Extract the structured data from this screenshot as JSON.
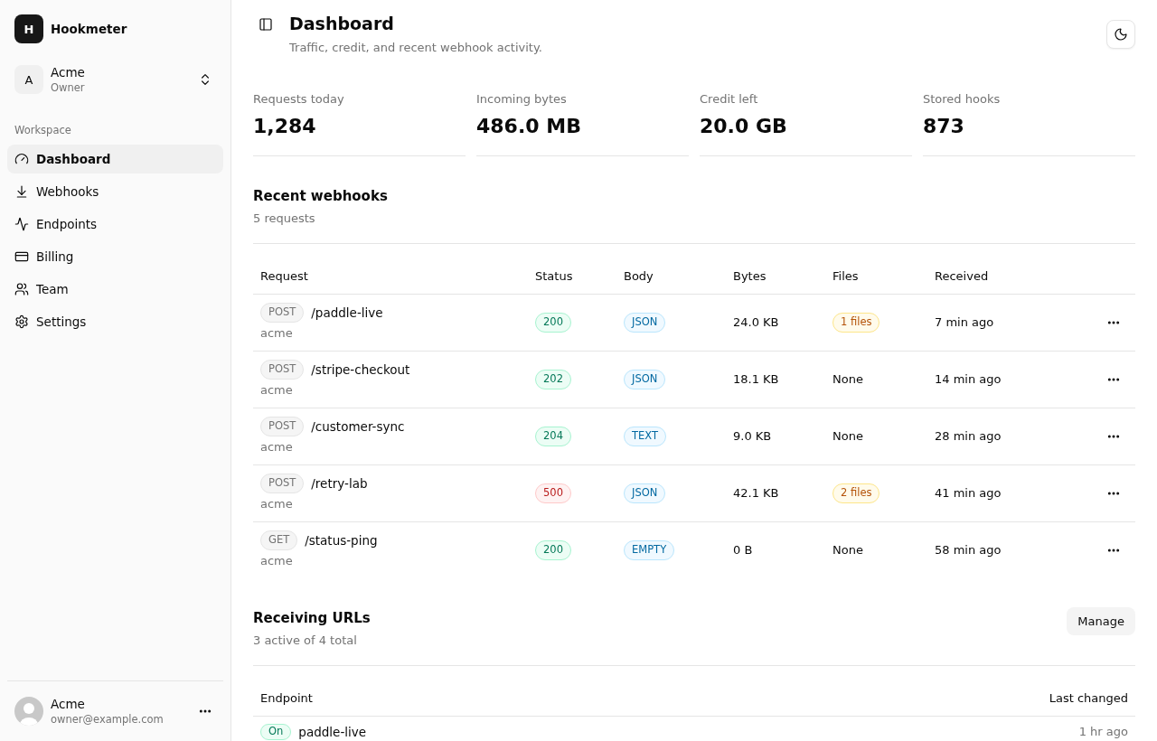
{
  "sidebar": {
    "brand": {
      "initial": "H",
      "name": "Hookmeter"
    },
    "org": {
      "initial": "A",
      "name": "Acme",
      "role": "Owner"
    },
    "section_label": "Workspace",
    "nav": [
      {
        "label": "Dashboard",
        "selected": true
      },
      {
        "label": "Webhooks",
        "selected": false
      },
      {
        "label": "Endpoints",
        "selected": false
      },
      {
        "label": "Billing",
        "selected": false
      },
      {
        "label": "Team",
        "selected": false
      },
      {
        "label": "Settings",
        "selected": false
      }
    ],
    "user": {
      "name": "Acme",
      "email": "owner@example.com"
    }
  },
  "header": {
    "title": "Dashboard",
    "subtitle": "Traffic, credit, and recent webhook activity."
  },
  "stats": [
    {
      "label": "Requests today",
      "value": "1,284"
    },
    {
      "label": "Incoming bytes",
      "value": "486.0 MB"
    },
    {
      "label": "Credit left",
      "value": "20.0 GB"
    },
    {
      "label": "Stored hooks",
      "value": "873"
    }
  ],
  "recent_webhooks": {
    "title": "Recent webhooks",
    "summary": "5 requests",
    "columns": [
      "Request",
      "Status",
      "Body",
      "Bytes",
      "Files",
      "Received"
    ],
    "rows": [
      {
        "method": "POST",
        "path": "/paddle-live",
        "source": "acme",
        "status": {
          "code": "200",
          "kind": "success"
        },
        "body": "JSON",
        "bytes": "24.0 KB",
        "files": {
          "kind": "badge",
          "text": "1 files"
        },
        "received": "7 min ago"
      },
      {
        "method": "POST",
        "path": "/stripe-checkout",
        "source": "acme",
        "status": {
          "code": "202",
          "kind": "success"
        },
        "body": "JSON",
        "bytes": "18.1 KB",
        "files": {
          "kind": "plain",
          "text": "None"
        },
        "received": "14 min ago"
      },
      {
        "method": "POST",
        "path": "/customer-sync",
        "source": "acme",
        "status": {
          "code": "204",
          "kind": "success"
        },
        "body": "TEXT",
        "bytes": "9.0 KB",
        "files": {
          "kind": "plain",
          "text": "None"
        },
        "received": "28 min ago"
      },
      {
        "method": "POST",
        "path": "/retry-lab",
        "source": "acme",
        "status": {
          "code": "500",
          "kind": "error"
        },
        "body": "JSON",
        "bytes": "42.1 KB",
        "files": {
          "kind": "badge",
          "text": "2 files"
        },
        "received": "41 min ago"
      },
      {
        "method": "GET",
        "path": "/status-ping",
        "source": "acme",
        "status": {
          "code": "200",
          "kind": "success"
        },
        "body": "EMPTY",
        "bytes": "0 B",
        "files": {
          "kind": "plain",
          "text": "None"
        },
        "received": "58 min ago"
      }
    ]
  },
  "receiving_urls": {
    "title": "Receiving URLs",
    "summary": "3 active of 4 total",
    "action": "Manage",
    "columns": [
      "Endpoint",
      "Last changed"
    ],
    "rows": [
      {
        "state_label": "On",
        "on": true,
        "name": "paddle-live",
        "changed": "1 hr ago"
      }
    ]
  }
}
